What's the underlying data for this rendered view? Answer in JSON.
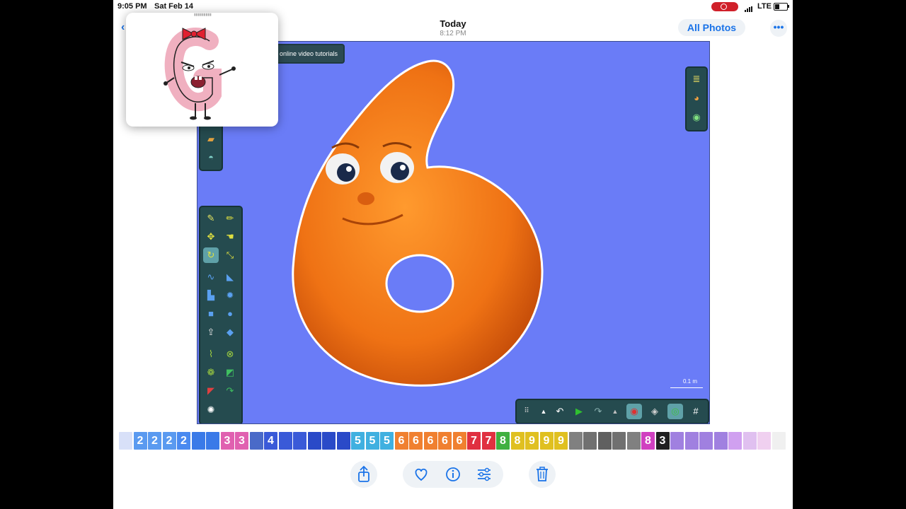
{
  "status_bar": {
    "time": "9:05 PM",
    "date": "Sat Feb 14",
    "network": "LTE"
  },
  "nav": {
    "title": "Today",
    "subtitle": "8:12 PM",
    "all_photos_label": "All Photos",
    "more_label": "•••"
  },
  "photo": {
    "tip_text": "online video tutorials",
    "scale_label": "0.1 m",
    "background_color": "#6a7cf7",
    "character_color": "#f07a1a"
  },
  "filmstrip": {
    "thumbnails": [
      "",
      "2",
      "2",
      "2",
      "2",
      "",
      "",
      "3",
      "3",
      "",
      "4",
      "",
      "",
      "",
      "",
      "",
      "5",
      "5",
      "5",
      "6",
      "6",
      "6",
      "6",
      "6",
      "7",
      "7",
      "8",
      "8",
      "9",
      "9",
      "9",
      "",
      "",
      "",
      "",
      "",
      "8",
      "3",
      "",
      "",
      "",
      "",
      "",
      "",
      "",
      ""
    ]
  },
  "bottom_bar": {
    "actions": [
      "share-icon",
      "heart-icon",
      "info-icon",
      "adjust-icon",
      "trash-icon"
    ]
  },
  "colors": {
    "accent": "#1a73e8",
    "toolbar": "#254b4f",
    "recording": "#d0202a"
  }
}
